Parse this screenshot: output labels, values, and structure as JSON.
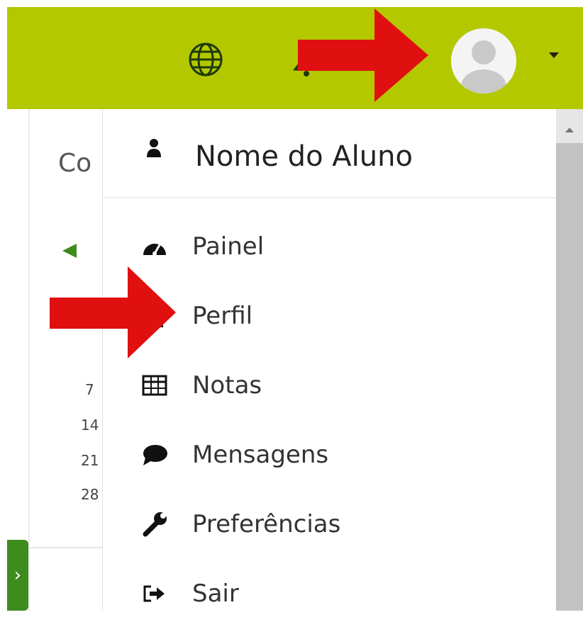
{
  "header": {
    "icons": [
      "globe-icon",
      "bell-icon",
      "user-avatar",
      "caret-down-icon"
    ],
    "accent_color": "#b4c800"
  },
  "background_page": {
    "heading_fragment": "Co",
    "calendar_days": [
      "7",
      "14",
      "21",
      "28"
    ]
  },
  "user_menu": {
    "user_name": "Nome do Aluno",
    "items": [
      {
        "label": "Painel",
        "icon": "dashboard-icon"
      },
      {
        "label": "Perfil",
        "icon": "user-icon"
      },
      {
        "label": "Notas",
        "icon": "table-icon"
      },
      {
        "label": "Mensagens",
        "icon": "comment-icon"
      },
      {
        "label": "Preferências",
        "icon": "wrench-icon"
      },
      {
        "label": "Sair",
        "icon": "sign-out-icon"
      }
    ]
  },
  "annotations": {
    "arrow_color": "#e01010",
    "arrows": [
      "points-to-avatar",
      "points-to-perfil"
    ]
  }
}
